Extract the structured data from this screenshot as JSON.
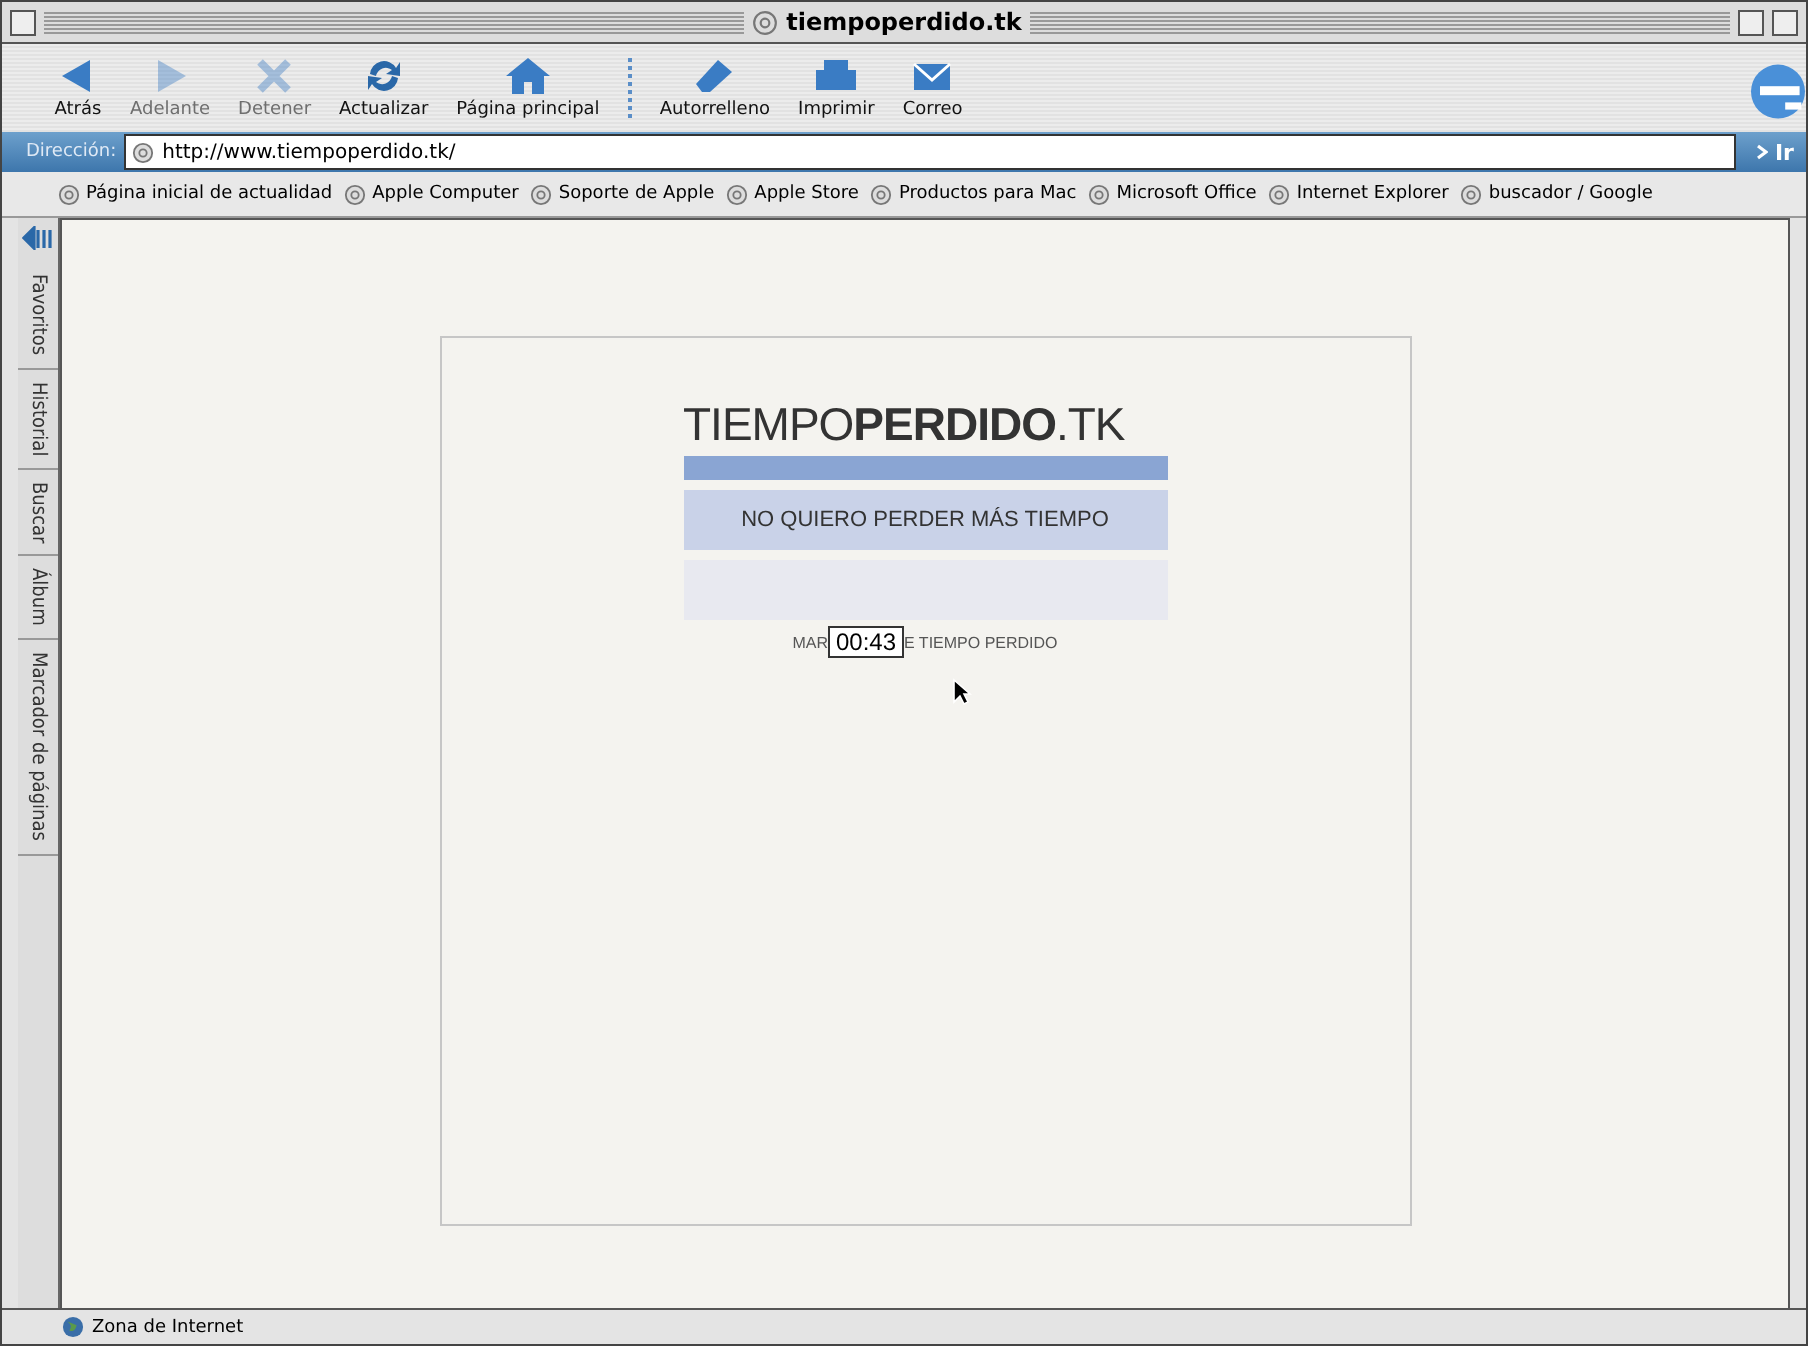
{
  "window": {
    "title": "tiempoperdido.tk"
  },
  "toolbar": [
    {
      "label": "Atrás",
      "kind": "back",
      "disabled": false
    },
    {
      "label": "Adelante",
      "kind": "forward",
      "disabled": true
    },
    {
      "label": "Detener",
      "kind": "stop",
      "disabled": true
    },
    {
      "label": "Actualizar",
      "kind": "refresh",
      "disabled": false
    },
    {
      "label": "Página principal",
      "kind": "home",
      "disabled": false
    },
    {
      "label": "Autorrelleno",
      "kind": "autofill",
      "disabled": false
    },
    {
      "label": "Imprimir",
      "kind": "print",
      "disabled": false
    },
    {
      "label": "Correo",
      "kind": "mail",
      "disabled": false
    }
  ],
  "address": {
    "label": "Dirección:",
    "value": "http://www.tiempoperdido.tk/",
    "go": "Ir"
  },
  "favorites": [
    "Página inicial de actualidad",
    "Apple Computer",
    "Soporte de Apple",
    "Apple Store",
    "Productos para Mac",
    "Microsoft Office",
    "Internet Explorer",
    "buscador / Google"
  ],
  "sidebar_tabs": [
    "Favoritos",
    "Historial",
    "Buscar",
    "Álbum",
    "Marcador de páginas"
  ],
  "page": {
    "logo": "TIEMPO**PERDIDO**.TK",
    "button": "NO QUIERO PERDER MÁS TIEMPO",
    "caption_start": "MAR",
    "caption_end": "E TIEMPO PERDIDO",
    "tooltip": "00:43"
  },
  "status_bar": {
    "text": "Zona de Internet"
  }
}
